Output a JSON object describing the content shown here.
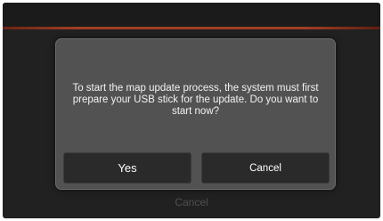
{
  "background": {
    "header_text": "",
    "bottom_cancel_label": "Cancel"
  },
  "dialog": {
    "message": "To start the map update process, the system must first prepare your USB stick for the update. Do you want to start now?",
    "yes_label": "Yes",
    "cancel_label": "Cancel"
  },
  "colors": {
    "accent": "#b8472a",
    "screen_bg": "#262626",
    "dialog_bg": "#525252",
    "button_bg": "#2a2a2a"
  }
}
